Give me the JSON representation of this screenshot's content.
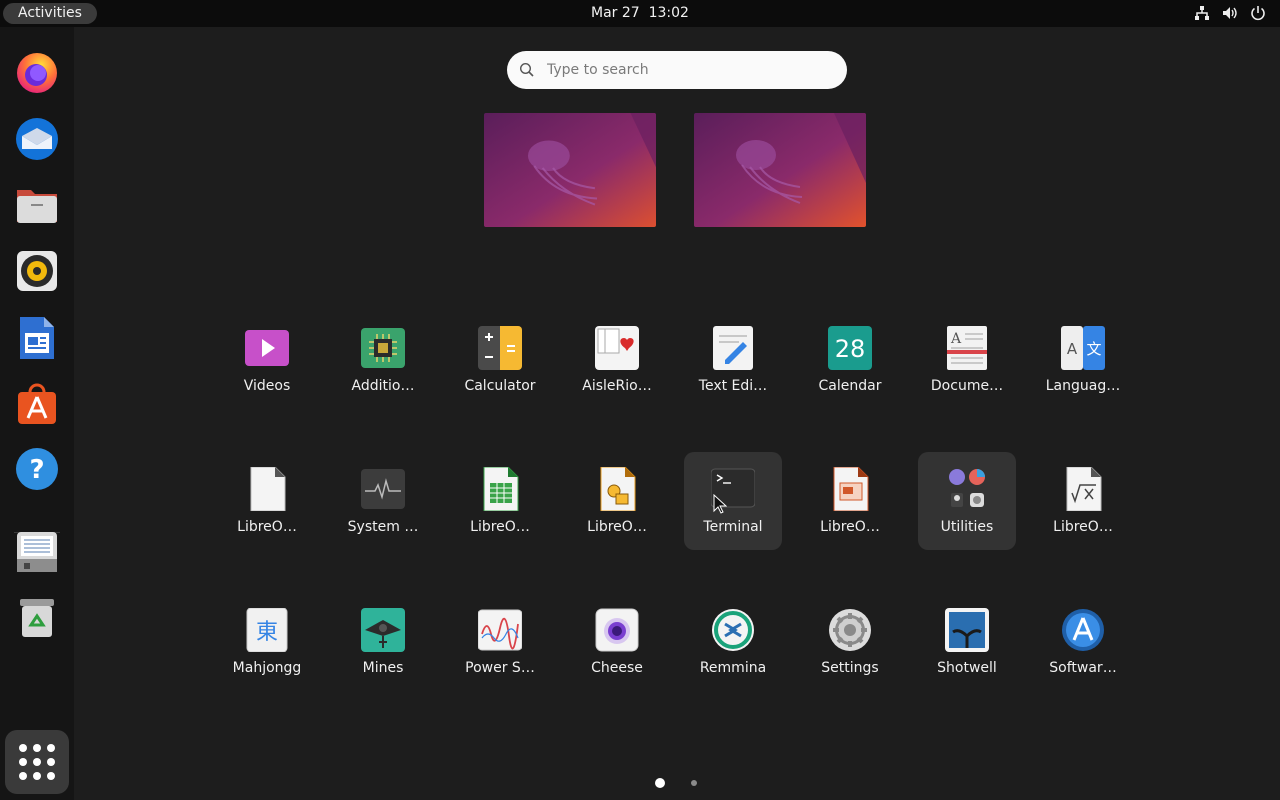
{
  "topbar": {
    "activities": "Activities",
    "date": "Mar 27",
    "time": "13:02",
    "tray_icons": [
      "network-icon",
      "volume-icon",
      "power-icon"
    ]
  },
  "dock": {
    "items": [
      {
        "name": "Firefox",
        "icon": "firefox-icon"
      },
      {
        "name": "Thunderbird",
        "icon": "thunderbird-icon"
      },
      {
        "name": "Files",
        "icon": "files-icon"
      },
      {
        "name": "Rhythmbox",
        "icon": "rhythmbox-icon"
      },
      {
        "name": "LibreOffice Writer",
        "icon": "writer-icon"
      },
      {
        "name": "Ubuntu Software",
        "icon": "ubuntu-software-icon"
      },
      {
        "name": "Help",
        "icon": "help-icon"
      },
      {
        "name": "Disk",
        "icon": "disk-icon"
      },
      {
        "name": "Trash",
        "icon": "trash-icon"
      }
    ],
    "show_apps_icon": "app-grid-icon"
  },
  "search": {
    "placeholder": "Type to search",
    "value": ""
  },
  "workspaces": [
    {
      "name": "workspace-1"
    },
    {
      "name": "workspace-2"
    }
  ],
  "apps": [
    [
      "Videos",
      "Additio…",
      "Calculator",
      "AisleRio…",
      "Text Edi…",
      "Calendar",
      "Docume…",
      "Languag…"
    ],
    [
      "LibreO…",
      "System …",
      "LibreO…",
      "LibreO…",
      "Terminal",
      "LibreO…",
      "Utilities",
      "LibreO…"
    ],
    [
      "Mahjongg",
      "Mines",
      "Power S…",
      "Cheese",
      "Remmina",
      "Settings",
      "Shotwell",
      "Softwar…"
    ]
  ],
  "calendar_icon_day": "28",
  "pager": {
    "pages": 2,
    "current": 1
  },
  "colors": {
    "background": "#1d1d1d",
    "topbar": "#0c0c0c",
    "dock": "#151515",
    "highlight": "#333333",
    "accent_orange": "#e95420"
  }
}
